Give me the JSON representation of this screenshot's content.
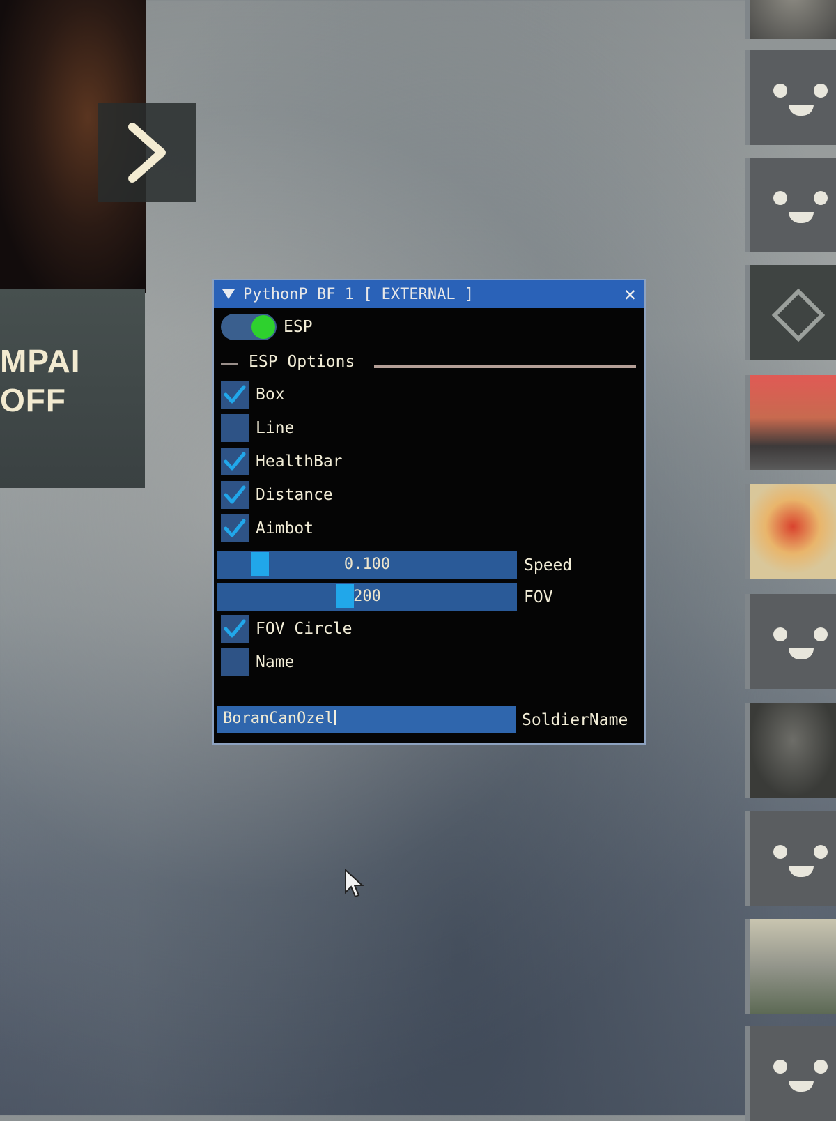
{
  "background": {
    "left_tile_text": [
      "MPAI",
      "OFF"
    ]
  },
  "window": {
    "title": "PythonP BF 1 [ EXTERNAL ]",
    "close_glyph": "✕",
    "esp_toggle": {
      "label": "ESP",
      "on": true
    },
    "section_title": "ESP Options",
    "checkboxes": [
      {
        "label": "Box",
        "checked": true
      },
      {
        "label": "Line",
        "checked": false
      },
      {
        "label": "HealthBar",
        "checked": true
      },
      {
        "label": "Distance",
        "checked": true
      },
      {
        "label": "Aimbot",
        "checked": true
      }
    ],
    "sliders": [
      {
        "value_text": "0.100",
        "label": "Speed",
        "fraction": 0.12
      },
      {
        "value_text": "200",
        "label": "FOV",
        "fraction": 0.42
      }
    ],
    "checkboxes2": [
      {
        "label": "FOV Circle",
        "checked": true
      },
      {
        "label": "Name",
        "checked": false
      }
    ],
    "name_input": {
      "value": "BoranCanOzel",
      "label": "SoldierName"
    }
  },
  "colors": {
    "accent": "#2a62b8",
    "toggle_on": "#2ed12e",
    "checkmark": "#21a7ea"
  }
}
